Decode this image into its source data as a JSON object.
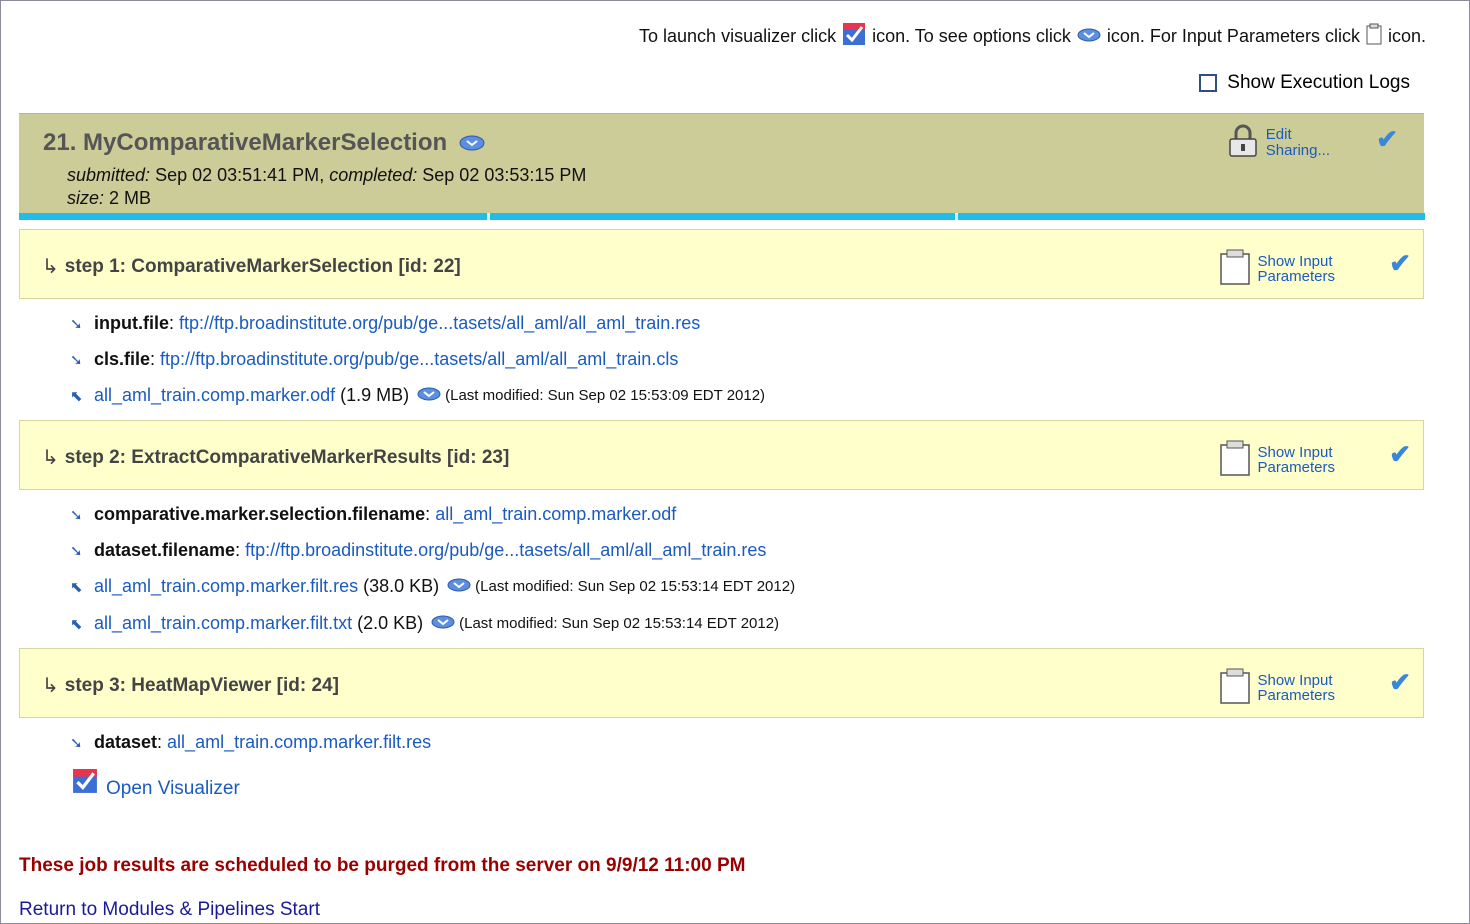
{
  "instructions": {
    "part1": "To launch visualizer click",
    "part2": "icon. To see options click",
    "part3": "icon. For Input Parameters click",
    "part4": "icon."
  },
  "exec_logs_label": "Show Execution Logs",
  "job": {
    "title": "21. MyComparativeMarkerSelection",
    "submitted_label": "submitted:",
    "submitted": "Sep 02 03:51:41 PM",
    "completed_label": "completed:",
    "completed": "Sep 02 03:53:15 PM",
    "size_label": "size:",
    "size": "2 MB",
    "edit_line1": "Edit",
    "edit_line2": "Sharing..."
  },
  "steps": [
    {
      "title": "step 1: ComparativeMarkerSelection [id: 22]",
      "params_line1": "Show Input",
      "params_line2": "Parameters",
      "inputs": [
        {
          "name": "input.file",
          "value": "ftp://ftp.broadinstitute.org/pub/ge...tasets/all_aml/all_aml_train.res"
        },
        {
          "name": "cls.file",
          "value": "ftp://ftp.broadinstitute.org/pub/ge...tasets/all_aml/all_aml_train.cls"
        }
      ],
      "outputs": [
        {
          "file": "all_aml_train.comp.marker.odf",
          "size": "(1.9 MB)",
          "modified": "(Last modified: Sun Sep 02 15:53:09 EDT 2012)"
        }
      ]
    },
    {
      "title": "step 2: ExtractComparativeMarkerResults [id: 23]",
      "params_line1": "Show Input",
      "params_line2": "Parameters",
      "inputs": [
        {
          "name": "comparative.marker.selection.filename",
          "value": "all_aml_train.comp.marker.odf"
        },
        {
          "name": "dataset.filename",
          "value": "ftp://ftp.broadinstitute.org/pub/ge...tasets/all_aml/all_aml_train.res"
        }
      ],
      "outputs": [
        {
          "file": "all_aml_train.comp.marker.filt.res",
          "size": "(38.0 KB)",
          "modified": "(Last modified: Sun Sep 02 15:53:14 EDT 2012)"
        },
        {
          "file": "all_aml_train.comp.marker.filt.txt",
          "size": "(2.0 KB)",
          "modified": "(Last modified: Sun Sep 02 15:53:14 EDT 2012)"
        }
      ]
    },
    {
      "title": "step 3: HeatMapViewer [id: 24]",
      "params_line1": "Show Input",
      "params_line2": "Parameters",
      "inputs": [
        {
          "name": "dataset",
          "value": "all_aml_train.comp.marker.filt.res"
        }
      ],
      "outputs": []
    }
  ],
  "open_visualizer": "Open Visualizer",
  "purge_notice": "These job results are scheduled to be purged from the server on 9/9/12 11:00 PM",
  "return_link": "Return to Modules & Pipelines Start",
  "colors": {
    "job_header": "#cccc99",
    "step_header": "#ffffcc",
    "accent_bar": "#1fbde8",
    "link": "#1a5bbf",
    "purge": "#990000"
  },
  "icons": [
    "visualizer-icon",
    "options-icon",
    "clipboard-icon",
    "lock-icon",
    "checkmark-icon",
    "input-arrow-icon",
    "output-arrow-icon"
  ]
}
